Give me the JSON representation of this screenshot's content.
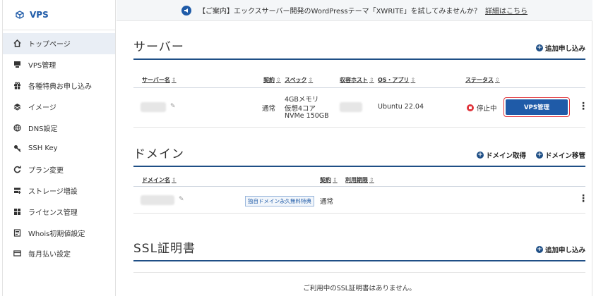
{
  "brand": {
    "name": "VPS"
  },
  "sidebar": {
    "items": [
      {
        "label": "トップページ",
        "icon": "home-icon"
      },
      {
        "label": "VPS管理",
        "icon": "server-icon"
      },
      {
        "label": "各種特典お申し込み",
        "icon": "gift-icon"
      },
      {
        "label": "イメージ",
        "icon": "layers-icon"
      },
      {
        "label": "DNS設定",
        "icon": "globe-icon"
      },
      {
        "label": "SSH Key",
        "icon": "key-icon"
      },
      {
        "label": "プラン変更",
        "icon": "refresh-icon"
      },
      {
        "label": "ストレージ増設",
        "icon": "storage-icon"
      },
      {
        "label": "ライセンス管理",
        "icon": "grid-icon"
      },
      {
        "label": "Whois初期値設定",
        "icon": "document-icon"
      },
      {
        "label": "毎月払い設定",
        "icon": "card-icon"
      }
    ]
  },
  "notice": {
    "text": "【ご案内】エックスサーバー開発のWordPressテーマ「XWRITE」を試してみませんか？",
    "link": "詳細はこちら"
  },
  "server": {
    "title": "サーバー",
    "add_label": "追加申し込み",
    "columns": {
      "name": "サーバー名",
      "contract": "契約",
      "spec": "スペック",
      "host": "収容ホスト",
      "os": "OS・アプリ",
      "status": "ステータス"
    },
    "row": {
      "contract": "通常",
      "spec1": "4GBメモリ",
      "spec2": "仮想4コア",
      "spec3": "NVMe 150GB",
      "os": "Ubuntu 22.04",
      "status": "停止中",
      "manage": "VPS管理"
    }
  },
  "domain": {
    "title": "ドメイン",
    "get_label": "ドメイン取得",
    "transfer_label": "ドメイン移管",
    "columns": {
      "name": "ドメイン名",
      "contract": "契約",
      "expiry": "利用期限"
    },
    "row": {
      "tag": "独自ドメイン永久無料特典",
      "contract": "通常"
    }
  },
  "ssl": {
    "title": "SSL証明書",
    "add_label": "追加申し込み",
    "empty": "ご利用中のSSL証明書はありません。"
  },
  "colors": {
    "primary": "#1f5ba8",
    "heading_rule": "#1f4f86",
    "alert": "#e0333a"
  }
}
